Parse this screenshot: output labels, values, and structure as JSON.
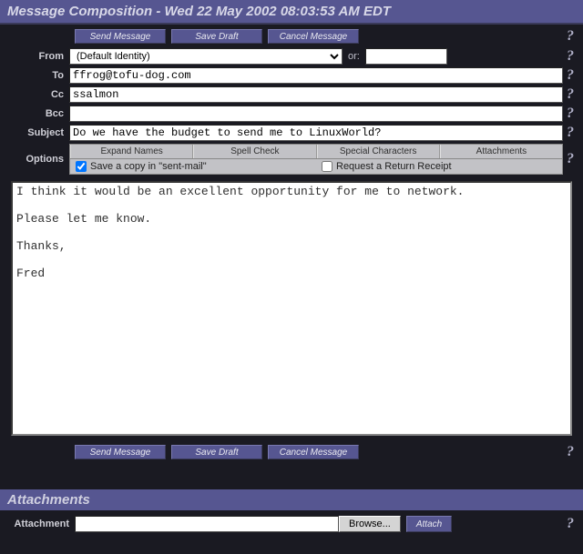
{
  "title": "Message Composition - Wed 22 May 2002 08:03:53 AM EDT",
  "topButtons": {
    "send": "Send Message",
    "draft": "Save Draft",
    "cancel": "Cancel Message"
  },
  "help": "?",
  "labels": {
    "from": "From",
    "to": "To",
    "cc": "Cc",
    "bcc": "Bcc",
    "subject": "Subject",
    "options": "Options",
    "or": "or:",
    "attachment": "Attachment"
  },
  "fields": {
    "fromSelect": "(Default Identity)",
    "fromOther": "",
    "to": "ffrog@tofu-dog.com",
    "cc": "ssalmon",
    "bcc": "",
    "subject": "Do we have the budget to send me to LinuxWorld?"
  },
  "toolbar": {
    "expand": "Expand Names",
    "spell": "Spell Check",
    "special": "Special Characters",
    "attach": "Attachments"
  },
  "checks": {
    "saveCopy": "Save a copy in \"sent-mail\"",
    "saveCopyChecked": true,
    "returnReceipt": "Request a Return Receipt",
    "returnReceiptChecked": false
  },
  "body": "I think it would be an excellent opportunity for me to network.\n\nPlease let me know.\n\nThanks,\n\nFred",
  "attachSection": {
    "title": "Attachments",
    "browse": "Browse...",
    "attachBtn": "Attach",
    "file": ""
  }
}
